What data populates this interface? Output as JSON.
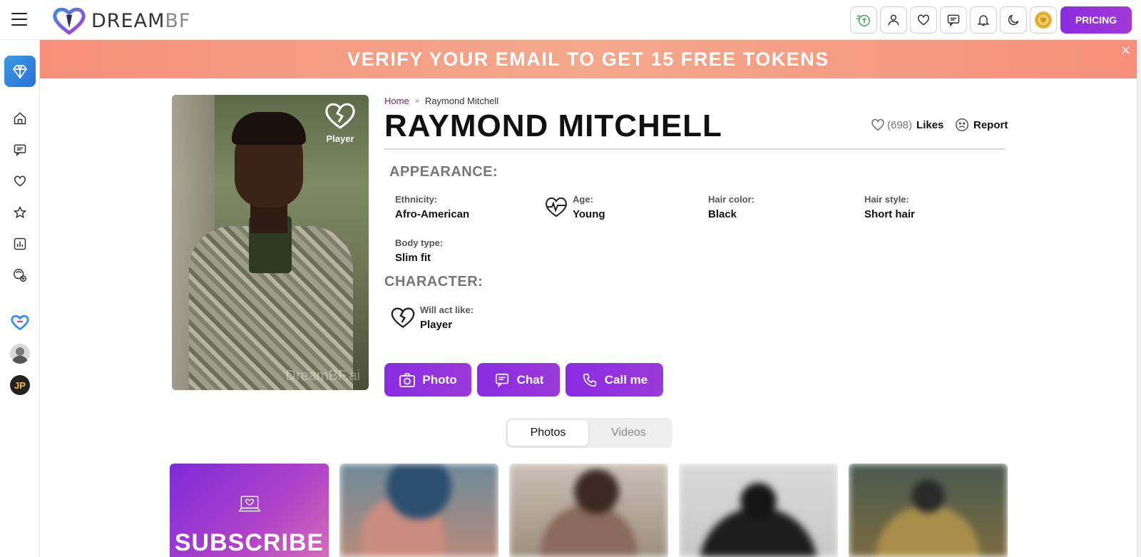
{
  "header": {
    "logo_text_main": "DREAM",
    "logo_text_accent": "BF",
    "icons": [
      "tokens-icon",
      "profile-icon",
      "heart-icon",
      "messages-icon",
      "bell-icon",
      "moon-icon",
      "coin-icon"
    ],
    "pricing_label": "PRICING"
  },
  "sidebar": {
    "items": [
      "premium-gem-icon",
      "home-icon",
      "chat-icon",
      "heart-icon",
      "star-icon",
      "gallery-icon",
      "generator-icon",
      "companion-avatar",
      "character-avatar",
      "user-avatar"
    ],
    "user_initials": "JP"
  },
  "banner": {
    "text": "VERIFY YOUR EMAIL TO GET 15 FREE TOKENS",
    "close": "×"
  },
  "profile": {
    "badge_label": "Player",
    "watermark": "DreamBF.ai",
    "breadcrumb": {
      "home": "Home",
      "separator": "»",
      "current": "Raymond Mitchell"
    },
    "name": "RAYMOND MITCHELL",
    "likes_count": "(698)",
    "likes_label": "Likes",
    "report_label": "Report"
  },
  "appearance": {
    "heading": "APPEARANCE:",
    "ethnicity_key": "Ethnicity:",
    "ethnicity": "Afro-American",
    "age_key": "Age:",
    "age": "Young",
    "hair_color_key": "Hair color:",
    "hair_color": "Black",
    "hair_style_key": "Hair style:",
    "hair_style": "Short hair",
    "body_type_key": "Body type:",
    "body_type": "Slim fit"
  },
  "character": {
    "heading": "CHARACTER:",
    "act_key": "Will act like:",
    "act": "Player"
  },
  "actions": {
    "photo": "Photo",
    "chat": "Chat",
    "call": "Call me"
  },
  "media_tabs": {
    "photos": "Photos",
    "videos": "Videos",
    "active": "photos"
  },
  "gallery": {
    "subscribe_label": "SUBSCRIBE"
  },
  "colors": {
    "brand_purple": "#8a2be2",
    "banner_coral": "#f6907a",
    "link_plum": "#7a1d6b"
  }
}
